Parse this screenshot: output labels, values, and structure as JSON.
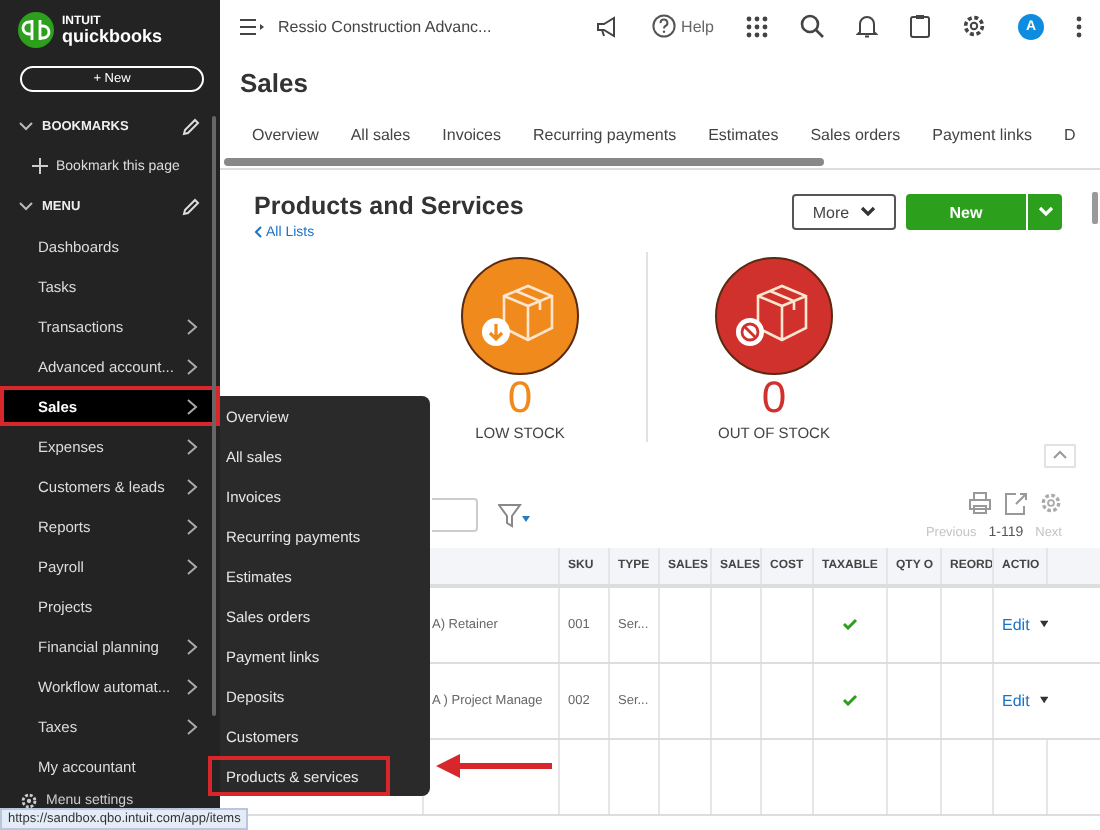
{
  "brand": {
    "line1": "INTUIT",
    "line2": "quickbooks"
  },
  "sidebar": {
    "new_button": "+ New",
    "sections": [
      {
        "label": "BOOKMARKS",
        "expanded": true
      },
      {
        "label": "MENU",
        "expanded": true
      }
    ],
    "bookmark_action": "Bookmark this page",
    "items": [
      {
        "label": "Dashboards",
        "has_submenu": false,
        "selected": false,
        "highlighted": false
      },
      {
        "label": "Tasks",
        "has_submenu": false,
        "selected": false,
        "highlighted": false
      },
      {
        "label": "Transactions",
        "has_submenu": true,
        "selected": false,
        "highlighted": false
      },
      {
        "label": "Advanced account...",
        "has_submenu": true,
        "selected": false,
        "highlighted": false
      },
      {
        "label": "Sales",
        "has_submenu": true,
        "selected": true,
        "highlighted": true
      },
      {
        "label": "Expenses",
        "has_submenu": true,
        "selected": false,
        "highlighted": false
      },
      {
        "label": "Customers & leads",
        "has_submenu": true,
        "selected": false,
        "highlighted": false
      },
      {
        "label": "Reports",
        "has_submenu": true,
        "selected": false,
        "highlighted": false
      },
      {
        "label": "Payroll",
        "has_submenu": true,
        "selected": false,
        "highlighted": false
      },
      {
        "label": "Projects",
        "has_submenu": false,
        "selected": false,
        "highlighted": false
      },
      {
        "label": "Financial planning",
        "has_submenu": true,
        "selected": false,
        "highlighted": false
      },
      {
        "label": "Workflow automat...",
        "has_submenu": true,
        "selected": false,
        "highlighted": false
      },
      {
        "label": "Taxes",
        "has_submenu": true,
        "selected": false,
        "highlighted": false
      },
      {
        "label": "My accountant",
        "has_submenu": false,
        "selected": false,
        "highlighted": false
      }
    ],
    "settings": "Menu settings"
  },
  "flyout": [
    {
      "label": "Overview",
      "highlighted": false
    },
    {
      "label": "All sales",
      "highlighted": false
    },
    {
      "label": "Invoices",
      "highlighted": false
    },
    {
      "label": "Recurring payments",
      "highlighted": false
    },
    {
      "label": "Estimates",
      "highlighted": false
    },
    {
      "label": "Sales orders",
      "highlighted": false
    },
    {
      "label": "Payment links",
      "highlighted": false
    },
    {
      "label": "Deposits",
      "highlighted": false
    },
    {
      "label": "Customers",
      "highlighted": false
    },
    {
      "label": "Products & services",
      "highlighted": true
    }
  ],
  "topbar": {
    "company": "Ressio Construction Advanc...",
    "help": "Help",
    "avatar": "A"
  },
  "page": {
    "title": "Sales",
    "tabs": [
      {
        "label": "Overview",
        "selected": false
      },
      {
        "label": "All sales",
        "selected": false
      },
      {
        "label": "Invoices",
        "selected": false
      },
      {
        "label": "Recurring payments",
        "selected": false
      },
      {
        "label": "Estimates",
        "selected": false
      },
      {
        "label": "Sales orders",
        "selected": false
      },
      {
        "label": "Payment links",
        "selected": false
      },
      {
        "label": "D",
        "selected": false
      }
    ],
    "heading": "Products and Services",
    "back_link": "All Lists",
    "more_button": "More",
    "new_button": "New"
  },
  "stock": [
    {
      "kind": "low",
      "count": "0",
      "label": "LOW STOCK",
      "color": "#f08a1c"
    },
    {
      "kind": "out",
      "count": "0",
      "label": "OUT OF STOCK",
      "color": "#d0312d"
    }
  ],
  "pagination": {
    "previous": "Previous",
    "previous_disabled": true,
    "range": "1-119",
    "next": "Next",
    "next_disabled": true
  },
  "table": {
    "columns": [
      "SKU",
      "TYPE",
      "SALES",
      "SALES",
      "COST",
      "TAXABLE",
      "QTY O",
      "REORD",
      "ACTIO"
    ],
    "rows": [
      {
        "name": "A) Retainer",
        "sku": "001",
        "type": "Ser...",
        "taxable": true,
        "action": "Edit"
      },
      {
        "name": "A ) Project Manage",
        "sku": "002",
        "type": "Ser...",
        "taxable": true,
        "action": "Edit"
      }
    ]
  },
  "status_url": "https://sandbox.qbo.intuit.com/app/items"
}
